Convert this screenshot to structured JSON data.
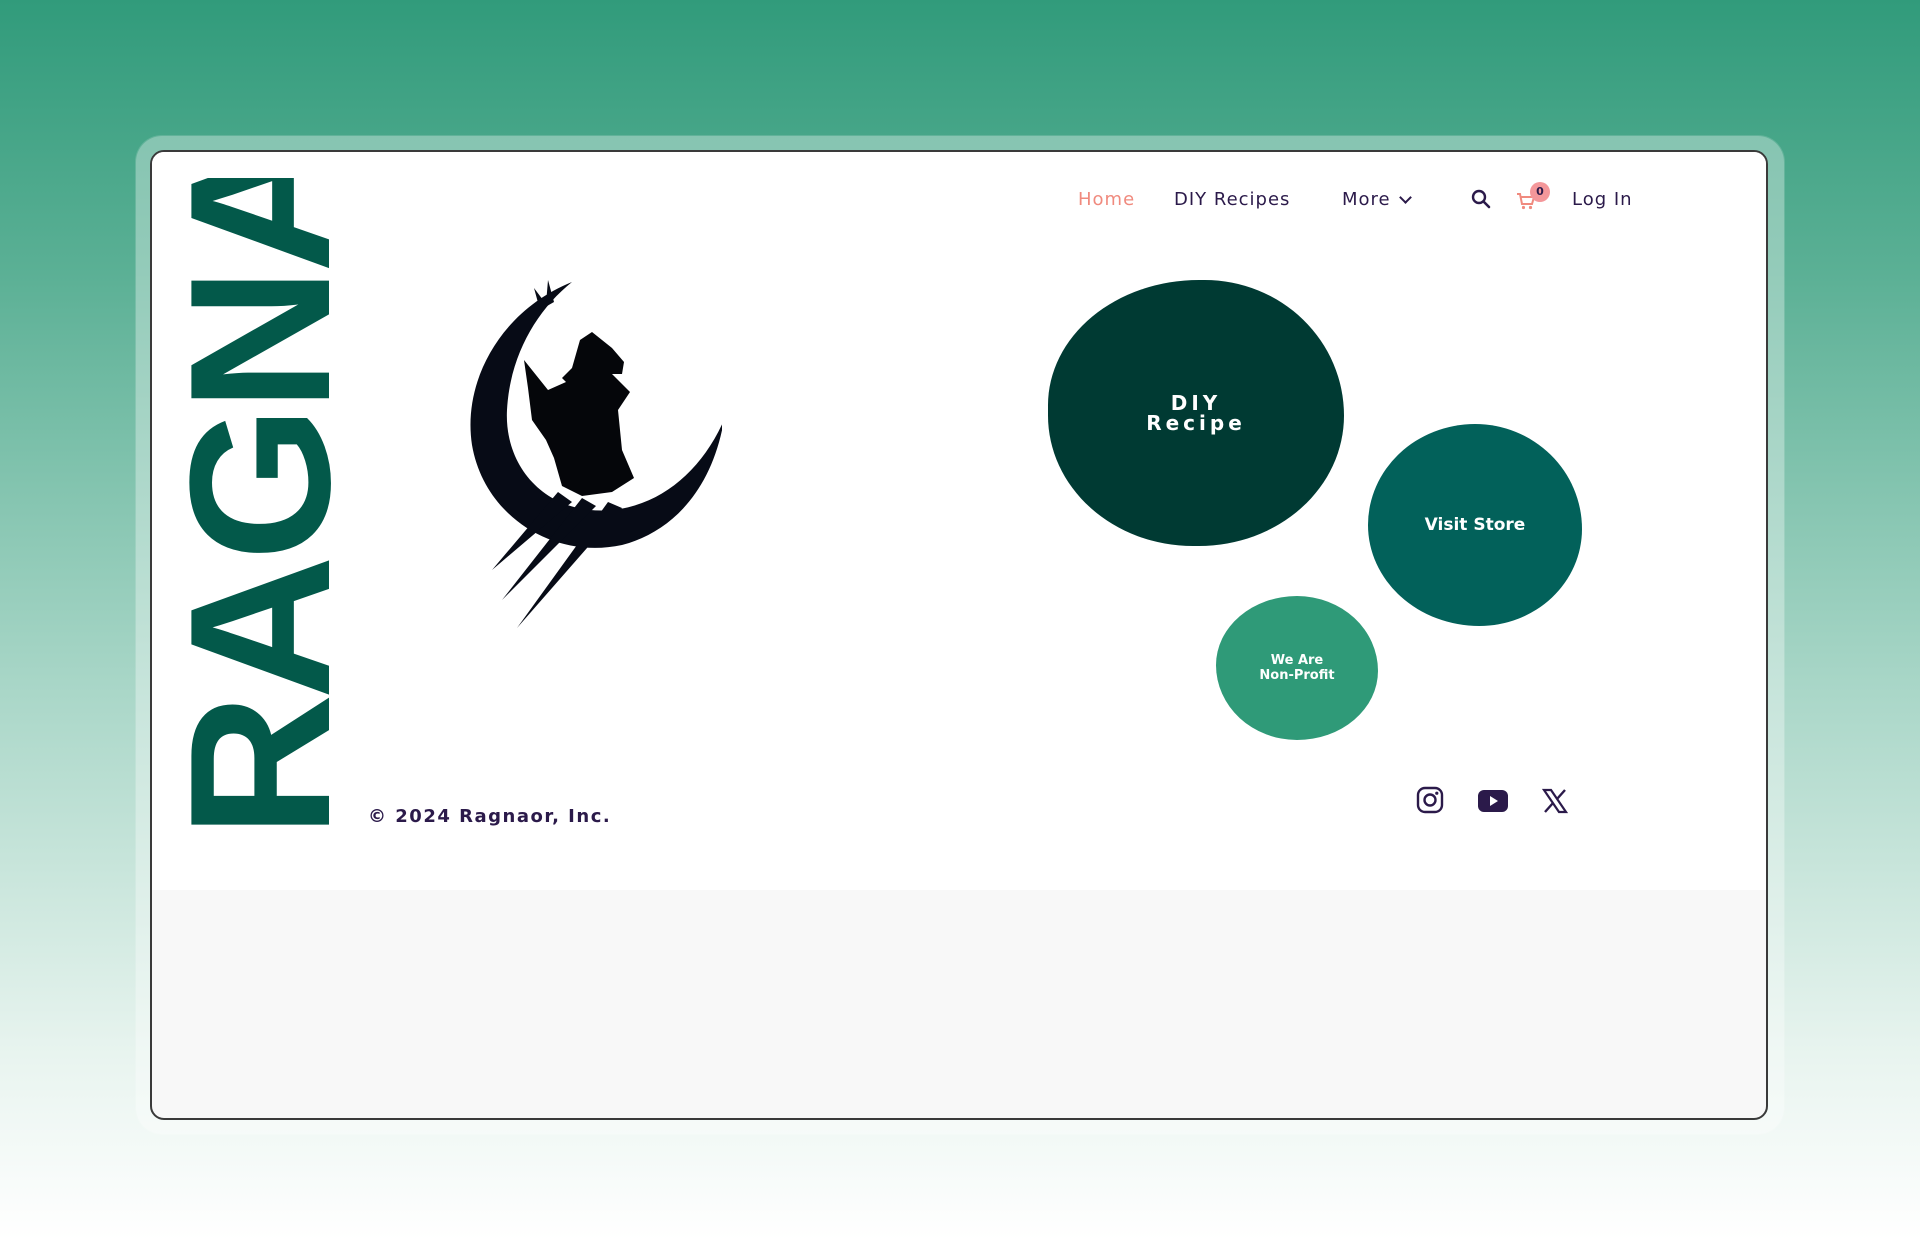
{
  "brand": {
    "name": "RAGNAOR",
    "color": "#03594a"
  },
  "nav": {
    "items": [
      {
        "label": "Home",
        "active": true
      },
      {
        "label": "DIY Recipes",
        "active": false
      },
      {
        "label": "More",
        "active": false
      }
    ],
    "login_label": "Log In",
    "cart_count": "0",
    "active_color": "#f08a7e",
    "text_color": "#2b1a4a"
  },
  "hero": {
    "diy_line1": "DIY",
    "diy_line2": "Recipe",
    "store_label": "Visit Store",
    "nonprofit_line1": "We Are",
    "nonprofit_line2": "Non-Profit"
  },
  "footer": {
    "copyright": "© 2024 Ragnaor, Inc.",
    "social": [
      "instagram-icon",
      "youtube-icon",
      "x-icon"
    ]
  },
  "colors": {
    "blob_dark": "#003a33",
    "blob_mid": "#02615a",
    "blob_light": "#2f9a78",
    "badge": "#f4979a"
  }
}
